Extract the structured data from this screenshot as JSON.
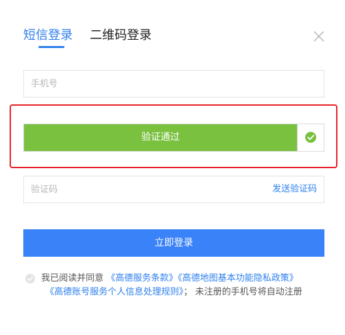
{
  "tabs": {
    "sms_label": "短信登录",
    "qr_label": "二维码登录"
  },
  "phone": {
    "placeholder": "手机号",
    "value": ""
  },
  "verify": {
    "label": "验证通过",
    "status_icon": "check-circle-icon",
    "success_color": "#79c13f"
  },
  "code": {
    "placeholder": "验证码",
    "value": "",
    "send_label": "发送验证码"
  },
  "login_button_label": "立即登录",
  "agreement": {
    "prefix": "我已阅读并同意",
    "terms_link": "《高德服务条款》",
    "privacy_link": "《高德地图基本功能隐私政策》",
    "account_link": "《高德账号服务个人信息处理规则》",
    "suffix": "； 未注册的手机号将自动注册"
  },
  "colors": {
    "accent": "#2f80ed",
    "button": "#3a82f7",
    "highlight_border": "#e8222a"
  }
}
